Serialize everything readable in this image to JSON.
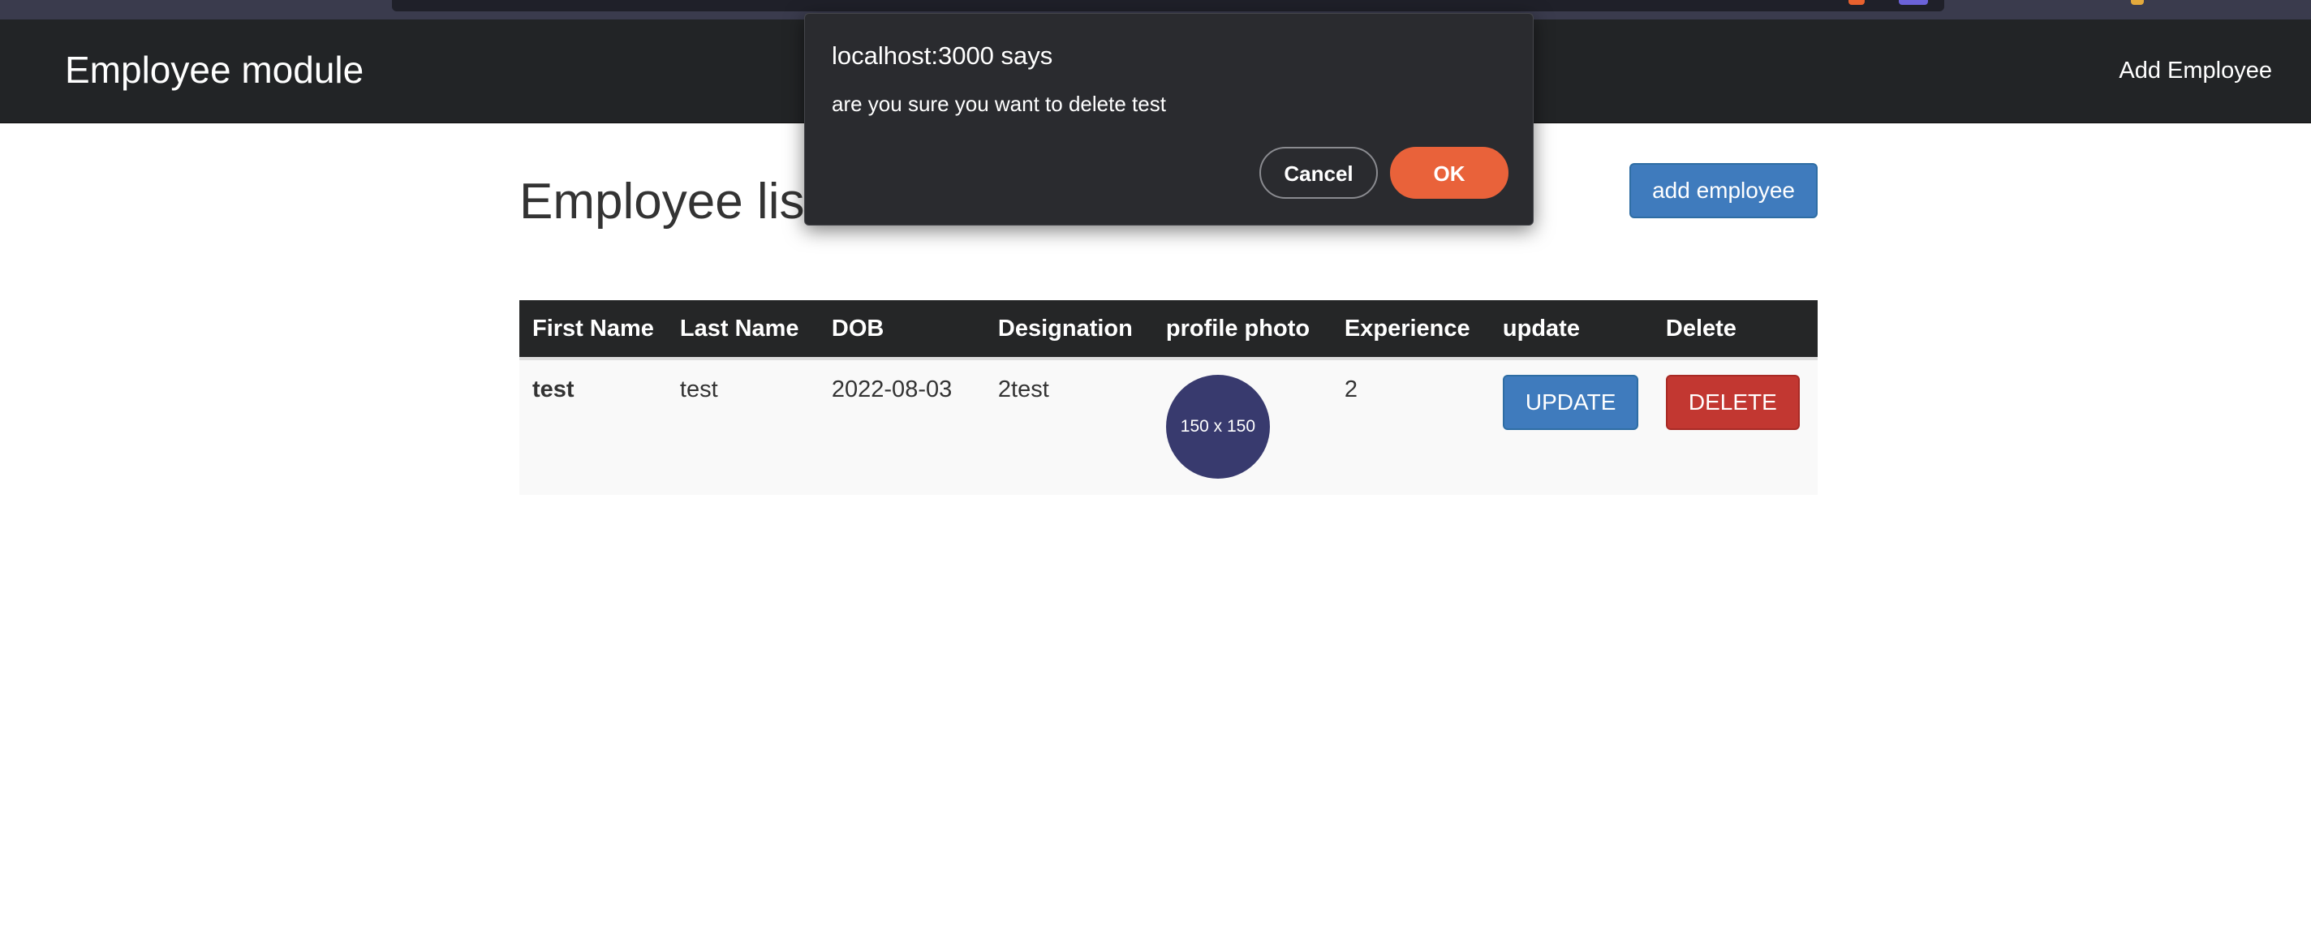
{
  "navbar": {
    "brand": "Employee module",
    "add_link": "Add Employee"
  },
  "main": {
    "title": "Employee list",
    "add_button": "add employee"
  },
  "table": {
    "columns": [
      "First Name",
      "Last Name",
      "DOB",
      "Designation",
      "profile photo",
      "Experience",
      "update",
      "Delete"
    ],
    "rows": [
      {
        "first_name": "test",
        "last_name": "test",
        "dob": "2022-08-03",
        "designation": "2test",
        "photo_placeholder": "150 x 150",
        "experience": "2",
        "update_label": "UPDATE",
        "delete_label": "DELETE"
      }
    ]
  },
  "dialog": {
    "title": "localhost:3000 says",
    "message": "are you sure you want to delete test",
    "cancel_label": "Cancel",
    "ok_label": "OK"
  },
  "colors": {
    "navbar_bg": "#222426",
    "primary": "#3f7bbd",
    "danger": "#c23731",
    "dialog_ok": "#e9623a",
    "avatar_bg": "#383a6e"
  }
}
